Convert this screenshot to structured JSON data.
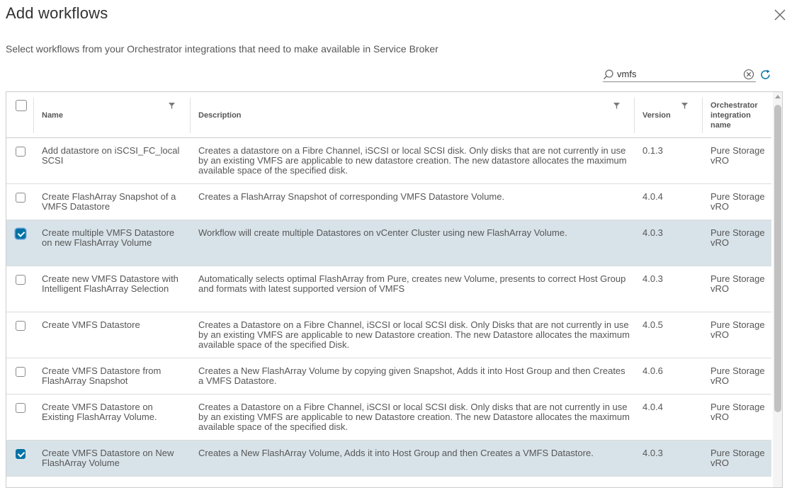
{
  "dialog": {
    "title": "Add workflows",
    "subtitle": "Select workflows from your Orchestrator integrations that need to make available in Service Broker",
    "close_icon": "close-icon"
  },
  "search": {
    "value": "vmfs",
    "icons": {
      "search": "search-icon",
      "clear": "clear-icon",
      "refresh": "refresh-icon"
    }
  },
  "table": {
    "columns": {
      "name": "Name",
      "description": "Description",
      "version": "Version",
      "orchestrator": [
        "Orchestrator",
        "integration",
        "name"
      ]
    },
    "rows": [
      {
        "name": "Add datastore on iSCSI_FC_local SCSI",
        "description": "Creates a datastore on a Fibre Channel, iSCSI or local SCSI disk. Only disks that are not currently in use by an existing VMFS are applicable to new datastore creation. The new datastore allocates the maximum available space of the specified disk.",
        "version": "0.1.3",
        "orchestrator": "Pure Storage vRO",
        "checked": false
      },
      {
        "name": "Create FlashArray Snapshot of a VMFS Datastore",
        "description": "Creates a FlashArray Snapshot of corresponding VMFS Datastore Volume.",
        "version": "4.0.4",
        "orchestrator": "Pure Storage vRO",
        "checked": false
      },
      {
        "name": "Create multiple VMFS Datastore on new FlashArray Volume",
        "description": "Workflow will create multiple Datastores on vCenter Cluster using new FlashArray Volume.",
        "version": "4.0.3",
        "orchestrator": "Pure Storage vRO",
        "checked": true
      },
      {
        "name": "Create new VMFS Datastore with Intelligent FlashArray Selection",
        "description": "Automatically selects optimal FlashArray from Pure, creates new Volume, presents to correct Host Group and formats with latest supported version of VMFS",
        "version": "4.0.3",
        "orchestrator": "Pure Storage vRO",
        "checked": false
      },
      {
        "name": "Create VMFS Datastore",
        "description": "Creates a Datastore on a Fibre Channel, iSCSI or local SCSI disk. Only Disks that are not currently in use by an existing VMFS are applicable to new Datastore creation. The new Datastore allocates the maximum available space of the specified Disk.",
        "version": "4.0.5",
        "orchestrator": "Pure Storage vRO",
        "checked": false
      },
      {
        "name": "Create VMFS Datastore from FlashArray Snapshot",
        "description": "Creates a New FlashArray Volume by copying given Snapshot, Adds it into Host Group and then Creates a VMFS Datastore.",
        "version": "4.0.6",
        "orchestrator": "Pure Storage vRO",
        "checked": false
      },
      {
        "name": "Create VMFS Datastore on Existing FlashArray Volume.",
        "description": "Creates a Datastore on a Fibre Channel, iSCSI or local SCSI disk. Only disks that are not currently in use by an existing VMFS are applicable to new Datastore creation. The new Datastore allocates the maximum available space of the specified disk.",
        "version": "4.0.4",
        "orchestrator": "Pure Storage vRO",
        "checked": false
      },
      {
        "name": "Create VMFS Datastore on New FlashArray Volume",
        "description": "Creates a New FlashArray Volume, Adds it into Host Group and then Creates a VMFS Datastore.",
        "version": "4.0.3",
        "orchestrator": "Pure Storage vRO",
        "checked": true
      }
    ]
  },
  "colors": {
    "accent": "#0072a3",
    "selected_row": "#d8e3e9",
    "border": "#cccccc"
  }
}
